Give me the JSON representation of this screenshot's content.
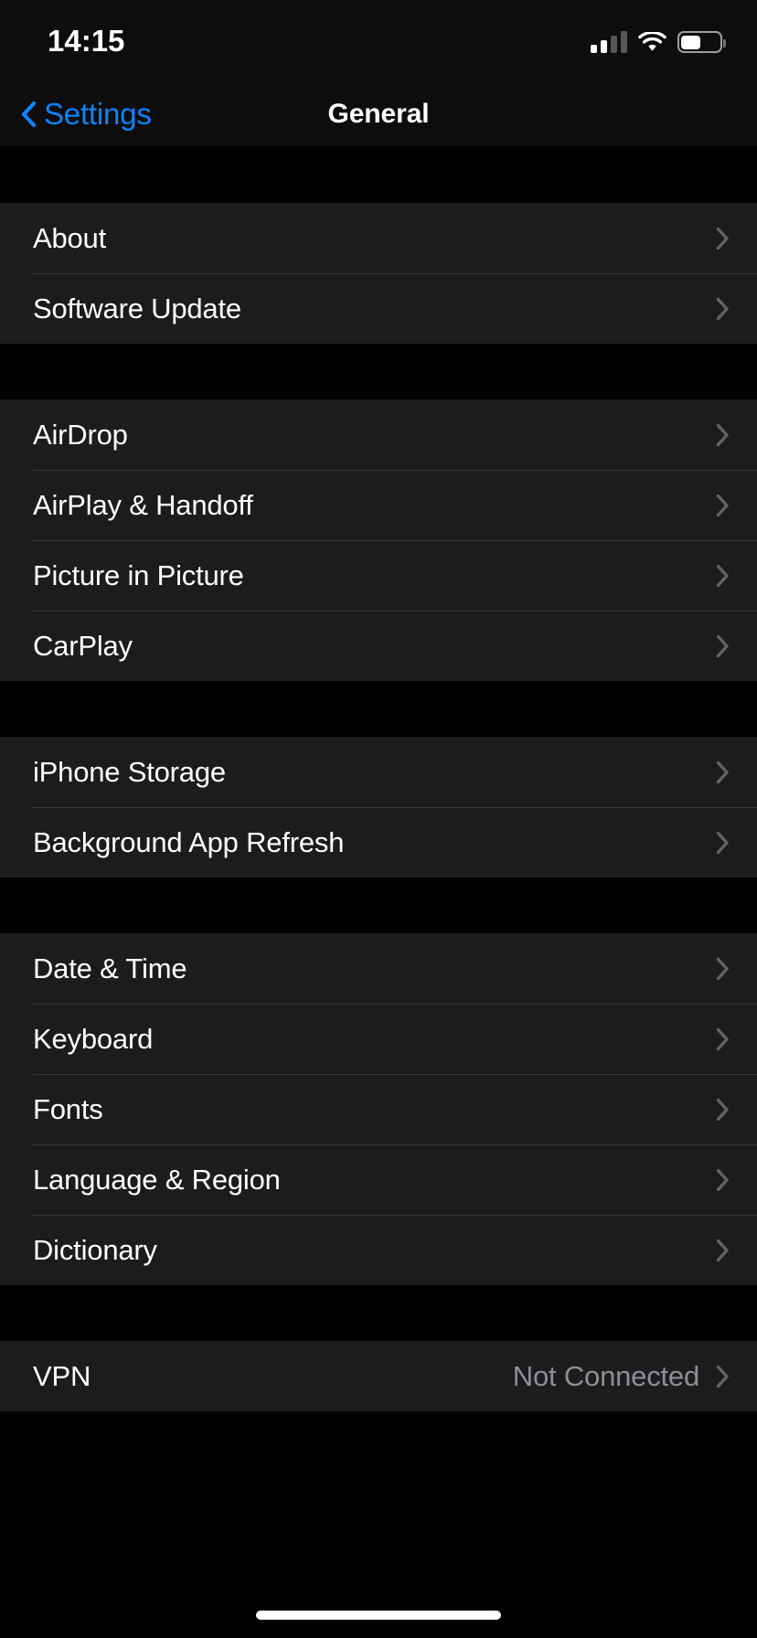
{
  "status_bar": {
    "time": "14:15",
    "cellular_icon": "cellular-signal-icon",
    "cellular_bars_active": 2,
    "cellular_bars_total": 4,
    "wifi_icon": "wifi-icon",
    "battery_icon": "battery-icon",
    "battery_percent": 50
  },
  "nav": {
    "back_icon": "chevron-left-icon",
    "back_label": "Settings",
    "title": "General"
  },
  "colors": {
    "accent": "#0A84FF",
    "row_background": "#1C1C1E",
    "page_background": "#000000",
    "separator": "#38383A",
    "primary_text": "#FFFFFF",
    "secondary_text": "#8E8E93",
    "chevron": "#636366"
  },
  "groups": [
    {
      "rows": [
        {
          "label": "About",
          "value": "",
          "accessory": "chevron-right-icon"
        },
        {
          "label": "Software Update",
          "value": "",
          "accessory": "chevron-right-icon"
        }
      ]
    },
    {
      "rows": [
        {
          "label": "AirDrop",
          "value": "",
          "accessory": "chevron-right-icon"
        },
        {
          "label": "AirPlay & Handoff",
          "value": "",
          "accessory": "chevron-right-icon"
        },
        {
          "label": "Picture in Picture",
          "value": "",
          "accessory": "chevron-right-icon"
        },
        {
          "label": "CarPlay",
          "value": "",
          "accessory": "chevron-right-icon"
        }
      ]
    },
    {
      "rows": [
        {
          "label": "iPhone Storage",
          "value": "",
          "accessory": "chevron-right-icon"
        },
        {
          "label": "Background App Refresh",
          "value": "",
          "accessory": "chevron-right-icon"
        }
      ]
    },
    {
      "rows": [
        {
          "label": "Date & Time",
          "value": "",
          "accessory": "chevron-right-icon"
        },
        {
          "label": "Keyboard",
          "value": "",
          "accessory": "chevron-right-icon"
        },
        {
          "label": "Fonts",
          "value": "",
          "accessory": "chevron-right-icon"
        },
        {
          "label": "Language & Region",
          "value": "",
          "accessory": "chevron-right-icon"
        },
        {
          "label": "Dictionary",
          "value": "",
          "accessory": "chevron-right-icon"
        }
      ]
    },
    {
      "rows": [
        {
          "label": "VPN",
          "value": "Not Connected",
          "accessory": "chevron-right-icon"
        }
      ]
    }
  ],
  "home_indicator": "home-indicator"
}
